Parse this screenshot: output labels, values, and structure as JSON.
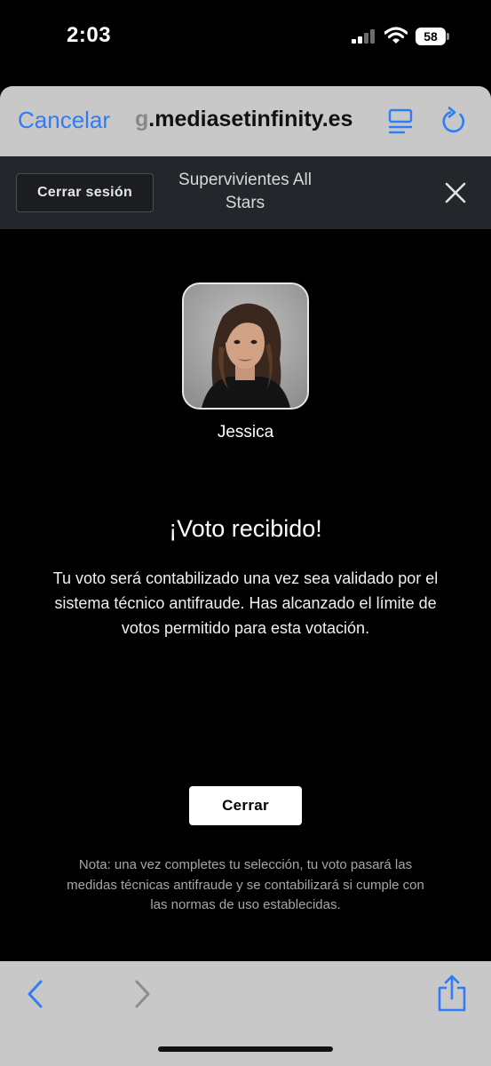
{
  "status_bar": {
    "time": "2:03",
    "battery": "58"
  },
  "browser": {
    "cancel_label": "Cancelar",
    "url_prefix": "g",
    "url_main": ".mediasetinfinity.es"
  },
  "site_header": {
    "logout_label": "Cerrar sesión",
    "title": "Supervivientes All Stars"
  },
  "candidate": {
    "name": "Jessica"
  },
  "confirmation": {
    "title": "¡Voto recibido!",
    "message": "Tu voto será contabilizado una vez sea validado por el sistema técnico antifraude. Has alcanzado el límite de votos permitido para esta votación.",
    "close_label": "Cerrar",
    "note": "Nota: una vez completes tu selección, tu voto pasará las medidas técnicas antifraude y se contabilizará si cumple con las normas de uso establecidas."
  },
  "icons": {
    "reader": "reader-view-icon",
    "reload": "reload-icon",
    "close": "close-icon",
    "back": "chevron-left-icon",
    "forward": "chevron-right-icon",
    "share": "share-icon"
  },
  "colors": {
    "accent": "#2f7cf6",
    "page_background": "#000000",
    "header_background": "#23262a",
    "browser_chrome": "#c8c8c8"
  }
}
